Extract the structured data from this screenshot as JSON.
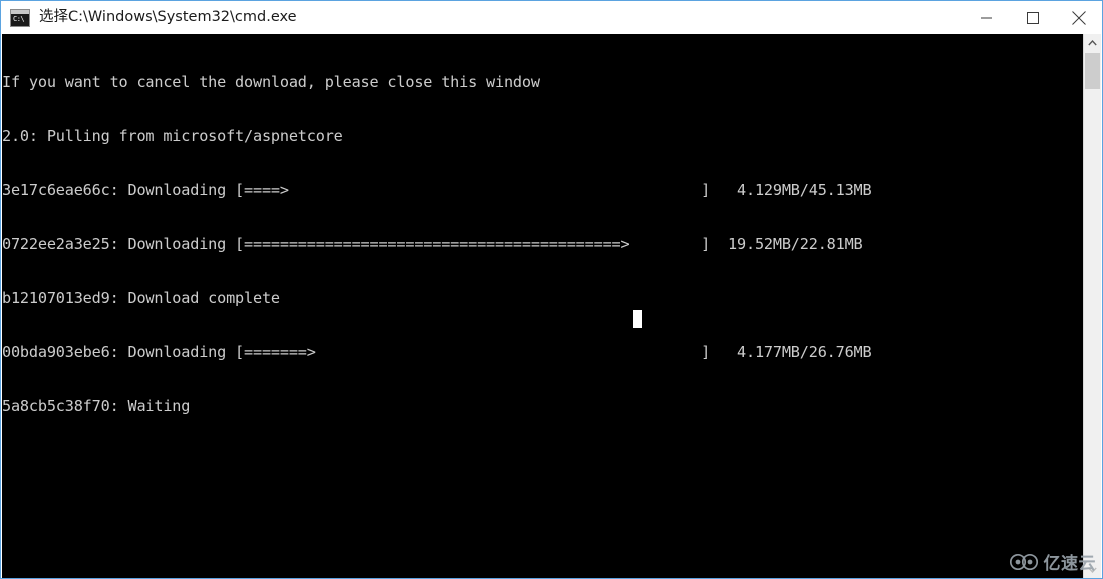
{
  "window": {
    "title": "选择C:\\Windows\\System32\\cmd.exe",
    "icon_name": "cmd-console-icon",
    "icon_glyph": "C:\\",
    "border_color": "#5ba3e0",
    "titlebar_bg": "#ffffff",
    "console_bg": "#000000",
    "console_fg": "#cccccc"
  },
  "window_controls": {
    "minimize_label": "Minimize",
    "maximize_label": "Maximize",
    "close_label": "Close"
  },
  "console": {
    "lines": [
      "If you want to cancel the download, please close this window",
      "2.0: Pulling from microsoft/aspnetcore",
      "3e17c6eae66c: Downloading [====>                                              ]   4.129MB/45.13MB",
      "0722ee2a3e25: Downloading [==========================================>        ]  19.52MB/22.81MB",
      "b12107013ed9: Download complete",
      "00bda903ebe6: Downloading [=======>                                           ]   4.177MB/26.76MB",
      "5a8cb5c38f70: Waiting"
    ],
    "cursor_visible": true
  },
  "docker_pull": {
    "notice": "If you want to cancel the download, please close this window",
    "tag": "2.0",
    "action": "Pulling from",
    "repository": "microsoft/aspnetcore",
    "layers": [
      {
        "id": "3e17c6eae66c",
        "status": "Downloading",
        "bar_filled": 4,
        "bar_total": 50,
        "downloaded": "4.129MB",
        "total": "45.13MB",
        "size_text": "4.129MB/45.13MB"
      },
      {
        "id": "0722ee2a3e25",
        "status": "Downloading",
        "bar_filled": 42,
        "bar_total": 50,
        "downloaded": "19.52MB",
        "total": "22.81MB",
        "size_text": "19.52MB/22.81MB"
      },
      {
        "id": "b12107013ed9",
        "status": "Download complete",
        "size_text": ""
      },
      {
        "id": "00bda903ebe6",
        "status": "Downloading",
        "bar_filled": 7,
        "bar_total": 50,
        "downloaded": "4.177MB",
        "total": "26.76MB",
        "size_text": "4.177MB/26.76MB"
      },
      {
        "id": "5a8cb5c38f70",
        "status": "Waiting",
        "size_text": ""
      }
    ]
  },
  "scrollbar": {
    "up_arrow": "▲",
    "down_arrow": "▼",
    "thumb_position": "top"
  },
  "watermark": {
    "text": "亿速云",
    "logo_name": "cloud-logo"
  }
}
